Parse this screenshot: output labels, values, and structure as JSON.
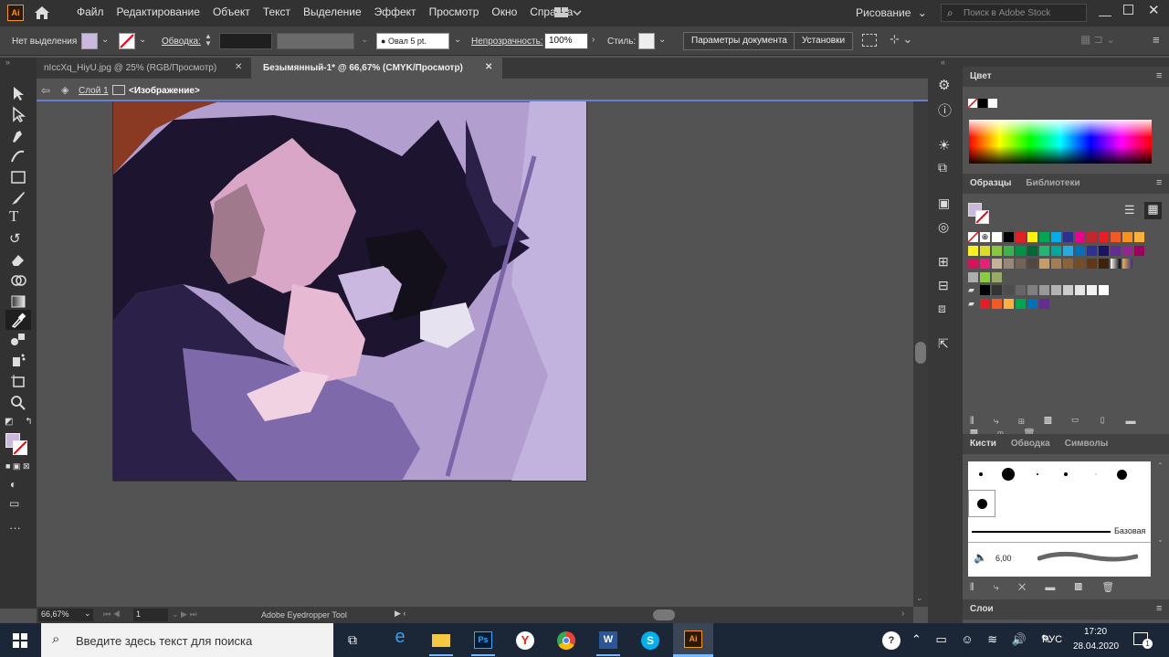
{
  "menubar": {
    "app_icon": "Ai",
    "items": [
      "Файл",
      "Редактирование",
      "Объект",
      "Текст",
      "Выделение",
      "Эффект",
      "Просмотр",
      "Окно",
      "Справка"
    ],
    "workspace": "Рисование",
    "stock_search_placeholder": "Поиск в Adobe Stock"
  },
  "control": {
    "selection": "Нет выделения",
    "stroke_label": "Обводка:",
    "brush": "Овал 5 pt.",
    "opacity_label": "Непрозрачность:",
    "opacity": "100%",
    "style_label": "Стиль:",
    "doc_settings": "Параметры документа",
    "prefs": "Установки"
  },
  "tabs": [
    {
      "label": "nIccXq_HiyU.jpg @ 25% (RGB/Просмотр)",
      "active": false
    },
    {
      "label": "Безымянный-1* @ 66,67% (CMYK/Просмотр)",
      "active": true
    }
  ],
  "breadcrumb": {
    "layer": "Слой 1",
    "object": "<Изображение>"
  },
  "status": {
    "zoom": "66,67%",
    "page": "1",
    "tool": "Adobe Eyedropper Tool"
  },
  "panels": {
    "color_title": "Цвет",
    "swatches_tabs": [
      "Образцы",
      "Библиотеки"
    ],
    "brushes_tabs": [
      "Кисти",
      "Обводка",
      "Символы"
    ],
    "brush_base": "Базовая",
    "brush_size": "6,00",
    "layers_title": "Слои"
  },
  "taskbar": {
    "search_placeholder": "Введите здесь текст для поиска",
    "lang": "РУС",
    "time": "17:20",
    "date": "28.04.2020",
    "notif_count": "1"
  },
  "colors": {
    "accent": "#6a7fd0",
    "fill": "#cbb8e0"
  }
}
